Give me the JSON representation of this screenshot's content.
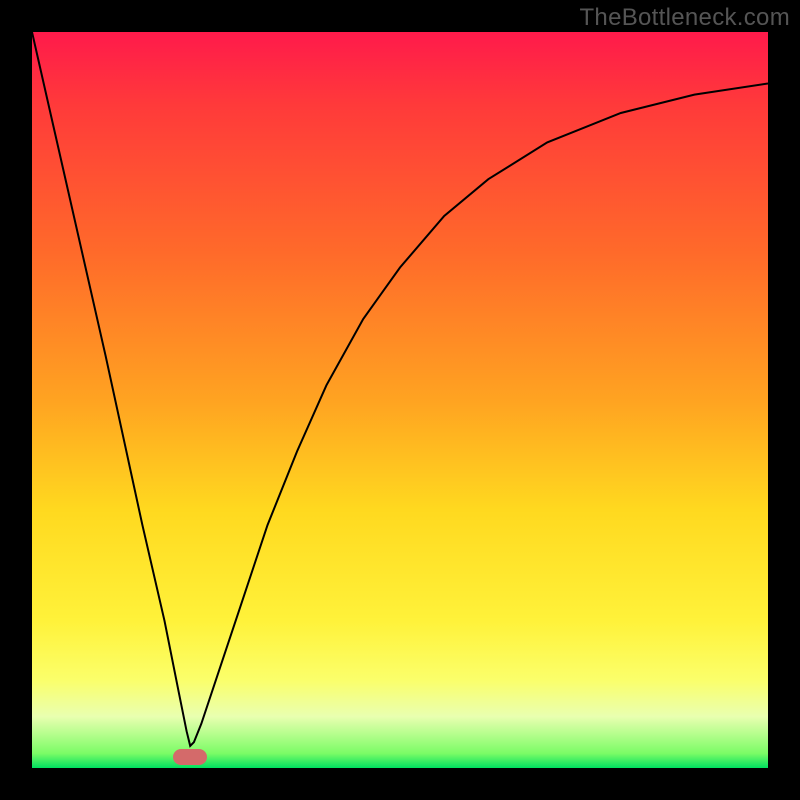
{
  "watermark": "TheBottleneck.com",
  "chart_data": {
    "type": "line",
    "title": "",
    "xlabel": "",
    "ylabel": "",
    "xlim": [
      0,
      1
    ],
    "ylim": [
      0,
      1
    ],
    "series": [
      {
        "name": "curve",
        "x": [
          0.0,
          0.05,
          0.1,
          0.15,
          0.18,
          0.2,
          0.21,
          0.215,
          0.22,
          0.23,
          0.25,
          0.28,
          0.32,
          0.36,
          0.4,
          0.45,
          0.5,
          0.56,
          0.62,
          0.7,
          0.8,
          0.9,
          1.0
        ],
        "y": [
          1.0,
          0.78,
          0.56,
          0.33,
          0.2,
          0.1,
          0.05,
          0.03,
          0.035,
          0.06,
          0.12,
          0.21,
          0.33,
          0.43,
          0.52,
          0.61,
          0.68,
          0.75,
          0.8,
          0.85,
          0.89,
          0.915,
          0.93
        ]
      }
    ],
    "marker": {
      "x": 0.215,
      "y": 0.015
    },
    "background_gradient": {
      "top": "#ff1a4b",
      "bottom": "#00e060"
    }
  }
}
